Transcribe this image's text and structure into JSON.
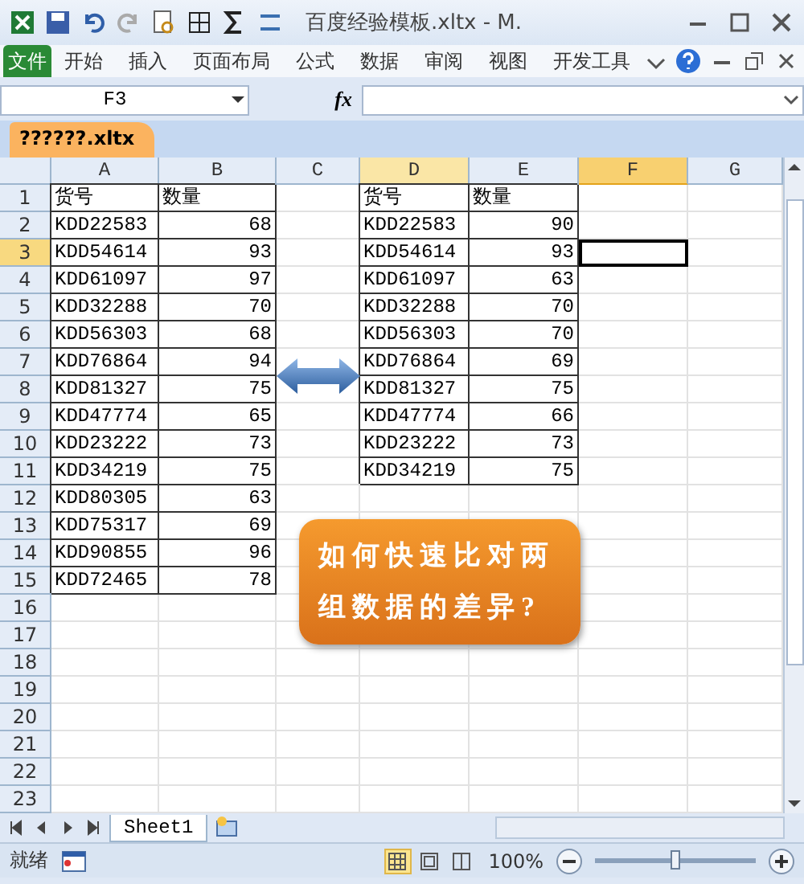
{
  "title_bar": {
    "title": "百度经验模板.xltx - M."
  },
  "ribbon": {
    "tabs": [
      {
        "label": "文件",
        "kind": "file",
        "selected": false
      },
      {
        "label": "开始",
        "kind": "tab",
        "selected": false
      },
      {
        "label": "插入",
        "kind": "tab",
        "selected": false
      },
      {
        "label": "页面布局",
        "kind": "tab",
        "selected": false
      },
      {
        "label": "公式",
        "kind": "tab",
        "selected": false
      },
      {
        "label": "数据",
        "kind": "tab",
        "selected": false
      },
      {
        "label": "审阅",
        "kind": "tab",
        "selected": false
      },
      {
        "label": "视图",
        "kind": "tab",
        "selected": false
      },
      {
        "label": "开发工具",
        "kind": "tab",
        "selected": false
      }
    ]
  },
  "formula_bar": {
    "name_box": "F3",
    "function_label": "fx"
  },
  "workbook_tab": {
    "label": "??????.xltx"
  },
  "sheet": {
    "columns": [
      {
        "label": "A",
        "selected": false,
        "highlighted": false
      },
      {
        "label": "B",
        "selected": false,
        "highlighted": false
      },
      {
        "label": "C",
        "selected": false,
        "highlighted": false
      },
      {
        "label": "D",
        "selected": false,
        "highlighted": true
      },
      {
        "label": "E",
        "selected": false,
        "highlighted": false
      },
      {
        "label": "F",
        "selected": true,
        "highlighted": true
      },
      {
        "label": "G",
        "selected": false,
        "highlighted": false
      }
    ],
    "rows": [
      {
        "number": "1",
        "selected": false,
        "cells": [
          {
            "text": "货号",
            "kind": "text"
          },
          {
            "text": "数量",
            "kind": "text"
          },
          null,
          {
            "text": "货号",
            "kind": "text"
          },
          {
            "text": "数量",
            "kind": "text"
          }
        ]
      },
      {
        "number": "2",
        "selected": false,
        "cells": [
          {
            "text": "KDD22583",
            "kind": "text"
          },
          {
            "text": "68",
            "kind": "number"
          },
          null,
          {
            "text": "KDD22583",
            "kind": "text"
          },
          {
            "text": "90",
            "kind": "number"
          }
        ]
      },
      {
        "number": "3",
        "selected": true,
        "cells": [
          {
            "text": "KDD54614",
            "kind": "text"
          },
          {
            "text": "93",
            "kind": "number"
          },
          null,
          {
            "text": "KDD54614",
            "kind": "text"
          },
          {
            "text": "93",
            "kind": "number"
          }
        ]
      },
      {
        "number": "4",
        "selected": false,
        "cells": [
          {
            "text": "KDD61097",
            "kind": "text"
          },
          {
            "text": "97",
            "kind": "number"
          },
          null,
          {
            "text": "KDD61097",
            "kind": "text"
          },
          {
            "text": "63",
            "kind": "number"
          }
        ]
      },
      {
        "number": "5",
        "selected": false,
        "cells": [
          {
            "text": "KDD32288",
            "kind": "text"
          },
          {
            "text": "70",
            "kind": "number"
          },
          null,
          {
            "text": "KDD32288",
            "kind": "text"
          },
          {
            "text": "70",
            "kind": "number"
          }
        ]
      },
      {
        "number": "6",
        "selected": false,
        "cells": [
          {
            "text": "KDD56303",
            "kind": "text"
          },
          {
            "text": "68",
            "kind": "number"
          },
          null,
          {
            "text": "KDD56303",
            "kind": "text"
          },
          {
            "text": "70",
            "kind": "number"
          }
        ]
      },
      {
        "number": "7",
        "selected": false,
        "cells": [
          {
            "text": "KDD76864",
            "kind": "text"
          },
          {
            "text": "94",
            "kind": "number"
          },
          null,
          {
            "text": "KDD76864",
            "kind": "text"
          },
          {
            "text": "69",
            "kind": "number"
          }
        ]
      },
      {
        "number": "8",
        "selected": false,
        "cells": [
          {
            "text": "KDD81327",
            "kind": "text"
          },
          {
            "text": "75",
            "kind": "number"
          },
          null,
          {
            "text": "KDD81327",
            "kind": "text"
          },
          {
            "text": "75",
            "kind": "number"
          }
        ]
      },
      {
        "number": "9",
        "selected": false,
        "cells": [
          {
            "text": "KDD47774",
            "kind": "text"
          },
          {
            "text": "65",
            "kind": "number"
          },
          null,
          {
            "text": "KDD47774",
            "kind": "text"
          },
          {
            "text": "66",
            "kind": "number"
          }
        ]
      },
      {
        "number": "10",
        "selected": false,
        "cells": [
          {
            "text": "KDD23222",
            "kind": "text"
          },
          {
            "text": "73",
            "kind": "number"
          },
          null,
          {
            "text": "KDD23222",
            "kind": "text"
          },
          {
            "text": "73",
            "kind": "number"
          }
        ]
      },
      {
        "number": "11",
        "selected": false,
        "cells": [
          {
            "text": "KDD34219",
            "kind": "text"
          },
          {
            "text": "75",
            "kind": "number"
          },
          null,
          {
            "text": "KDD34219",
            "kind": "text"
          },
          {
            "text": "75",
            "kind": "number"
          }
        ]
      },
      {
        "number": "12",
        "selected": false,
        "cells": [
          {
            "text": "KDD80305",
            "kind": "text"
          },
          {
            "text": "63",
            "kind": "number"
          }
        ]
      },
      {
        "number": "13",
        "selected": false,
        "cells": [
          {
            "text": "KDD75317",
            "kind": "text"
          },
          {
            "text": "69",
            "kind": "number"
          }
        ]
      },
      {
        "number": "14",
        "selected": false,
        "cells": [
          {
            "text": "KDD90855",
            "kind": "text"
          },
          {
            "text": "96",
            "kind": "number"
          }
        ]
      },
      {
        "number": "15",
        "selected": false,
        "cells": [
          {
            "text": "KDD72465",
            "kind": "text"
          },
          {
            "text": "78",
            "kind": "number"
          }
        ]
      },
      {
        "number": "16",
        "selected": false
      },
      {
        "number": "17",
        "selected": false
      },
      {
        "number": "18",
        "selected": false
      },
      {
        "number": "19",
        "selected": false
      },
      {
        "number": "20",
        "selected": false
      },
      {
        "number": "21",
        "selected": false
      },
      {
        "number": "22",
        "selected": false
      },
      {
        "number": "23",
        "selected": false
      }
    ]
  },
  "callout": {
    "lines": [
      "如何快速比对两",
      "组数据的差异?"
    ]
  },
  "sheet_tabs": [
    {
      "label": "Sheet1",
      "selected": true
    }
  ],
  "status_bar": {
    "status": "就绪",
    "views": [
      {
        "kind": "normal",
        "selected": true
      },
      {
        "kind": "layout",
        "selected": false
      },
      {
        "kind": "break",
        "selected": false
      }
    ],
    "zoom": "100%",
    "zoom_slider": {
      "level": 0.5
    }
  }
}
